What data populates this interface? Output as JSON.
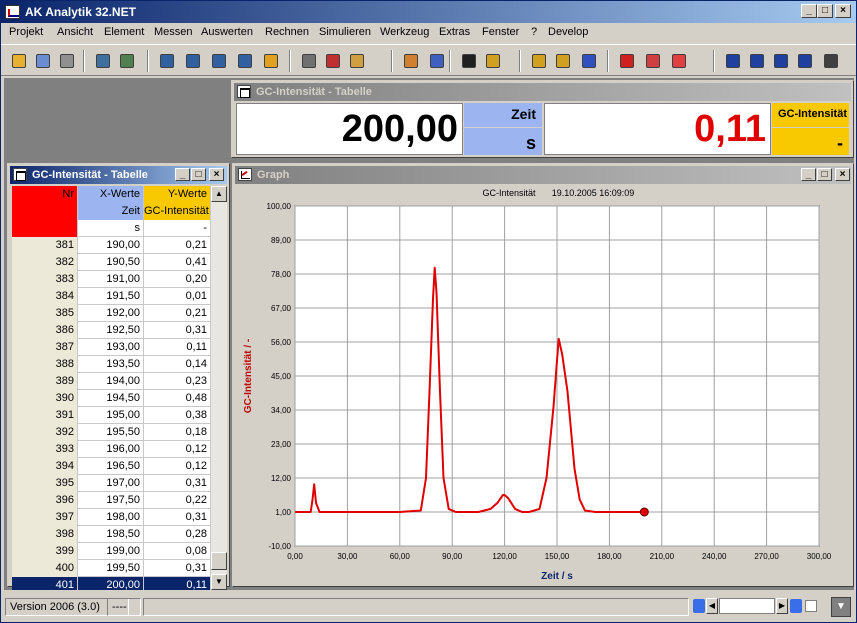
{
  "app": {
    "title": "AK Analytik 32.NET"
  },
  "menu": [
    "Projekt",
    "Ansicht",
    "Element",
    "Messen",
    "Auswerten",
    "Rechnen",
    "Simulieren",
    "Werkzeug",
    "Extras",
    "Fenster",
    "?",
    "Develop"
  ],
  "caption_buttons": {
    "minimize": "_",
    "maximize": "□",
    "close": "×"
  },
  "toolbar_icons": [
    "open-folder-icon",
    "open-file-icon",
    "search-file-icon",
    "network-icon",
    "hardware-icon",
    "table-view-icon",
    "graph-view-icon",
    "chart-window-icon",
    "list-window-icon",
    "palette-icon",
    "copy-icon",
    "cut-icon",
    "paste-icon",
    "new-doc-icon",
    "edit-doc-icon",
    "pointer-icon",
    "zoom-icon",
    "crosshair-icon",
    "move-icon",
    "peak-icon",
    "text-icon",
    "pen-icon",
    "eraser-icon",
    "chart-a-icon",
    "chart-b-icon",
    "chart-c-icon",
    "chart-d-icon",
    "tile-icon"
  ],
  "display": {
    "title": "GC-Intensität - Tabelle",
    "x_value": "200,00",
    "x_name": "Zeit",
    "x_unit": "s",
    "y_value": "0,11",
    "y_name": "GC-Intensität",
    "y_unit": "-"
  },
  "table": {
    "title": "GC-Intensität - Tabelle",
    "header": {
      "nr": "Nr",
      "x": "X-Werte",
      "y": "Y-Werte"
    },
    "names": {
      "x": "Zeit",
      "y": "GC-Intensität"
    },
    "units": {
      "x": "s",
      "y": "-"
    },
    "rows": [
      [
        "381",
        "190,00",
        "0,21"
      ],
      [
        "382",
        "190,50",
        "0,41"
      ],
      [
        "383",
        "191,00",
        "0,20"
      ],
      [
        "384",
        "191,50",
        "0,01"
      ],
      [
        "385",
        "192,00",
        "0,21"
      ],
      [
        "386",
        "192,50",
        "0,31"
      ],
      [
        "387",
        "193,00",
        "0,11"
      ],
      [
        "388",
        "193,50",
        "0,14"
      ],
      [
        "389",
        "194,00",
        "0,23"
      ],
      [
        "390",
        "194,50",
        "0,48"
      ],
      [
        "391",
        "195,00",
        "0,38"
      ],
      [
        "392",
        "195,50",
        "0,18"
      ],
      [
        "393",
        "196,00",
        "0,12"
      ],
      [
        "394",
        "196,50",
        "0,12"
      ],
      [
        "395",
        "197,00",
        "0,31"
      ],
      [
        "396",
        "197,50",
        "0,22"
      ],
      [
        "397",
        "198,00",
        "0,31"
      ],
      [
        "398",
        "198,50",
        "0,28"
      ],
      [
        "399",
        "199,00",
        "0,08"
      ],
      [
        "400",
        "199,50",
        "0,31"
      ],
      [
        "401",
        "200,00",
        "0,11"
      ],
      [
        "402",
        "...",
        "..."
      ]
    ],
    "selected_row": 20
  },
  "graph": {
    "title": "Graph"
  },
  "chart_data": {
    "type": "line",
    "title": "GC-Intensität",
    "subtitle": "19.10.2005 16:09:09",
    "xlabel": "Zeit / s",
    "ylabel": "GC-Intensität / -",
    "xlim": [
      0,
      300
    ],
    "ylim": [
      -10,
      100
    ],
    "xticks": [
      "0,00",
      "30,00",
      "60,00",
      "90,00",
      "120,00",
      "150,00",
      "180,00",
      "210,00",
      "240,00",
      "270,00",
      "300,00"
    ],
    "yticks": [
      "-10,00",
      "1,00",
      "12,00",
      "23,00",
      "34,00",
      "45,00",
      "56,00",
      "67,00",
      "78,00",
      "89,00",
      "100,00"
    ],
    "grid": true,
    "line_color": "#e00000",
    "x": [
      0,
      9,
      10,
      11,
      12,
      14,
      60,
      72,
      75,
      77,
      79,
      80,
      81,
      83,
      85,
      88,
      92,
      96,
      105,
      112,
      116,
      119,
      120,
      122,
      126,
      130,
      134,
      140,
      144,
      148,
      150,
      151,
      153,
      156,
      160,
      163,
      166,
      172,
      185,
      200
    ],
    "y": [
      1,
      1,
      5,
      10,
      4,
      1,
      1,
      1.5,
      12,
      40,
      70,
      80,
      72,
      40,
      12,
      2,
      1,
      1,
      1,
      2,
      4,
      6.5,
      6.5,
      5.5,
      2,
      1,
      1,
      2,
      12,
      35,
      50,
      57,
      52,
      40,
      15,
      5,
      1.5,
      1,
      1,
      1
    ],
    "marker_point": [
      200,
      1
    ]
  },
  "status": {
    "version": "Version 2006  (3.0)",
    "mode": "----"
  }
}
